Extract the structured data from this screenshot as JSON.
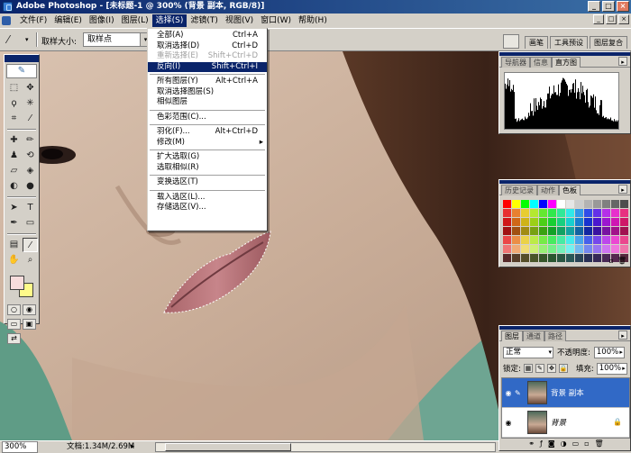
{
  "window": {
    "title": "Adobe Photoshop - [未标题-1 @ 300% (背景 副本, RGB/8)]",
    "minimize": "_",
    "maximize": "□",
    "close": "×"
  },
  "menubar": {
    "items": [
      "文件(F)",
      "编辑(E)",
      "图像(I)",
      "图层(L)",
      "选择(S)",
      "滤镜(T)",
      "视图(V)",
      "窗口(W)",
      "帮助(H)"
    ]
  },
  "options_bar": {
    "label": "取样大小:",
    "value": "取样点",
    "tabs": [
      "画笔",
      "工具预设",
      "图层复合"
    ]
  },
  "select_menu": {
    "items": [
      {
        "label": "全部(A)",
        "shortcut": "Ctrl+A"
      },
      {
        "label": "取消选择(D)",
        "shortcut": "Ctrl+D"
      },
      {
        "label": "重新选择(E)",
        "shortcut": "Shift+Ctrl+D"
      },
      {
        "label": "反向(I)",
        "shortcut": "Shift+Ctrl+I"
      },
      {
        "label": "所有图层(Y)",
        "shortcut": "Alt+Ctrl+A"
      },
      {
        "label": "取消选择图层(S)",
        "shortcut": ""
      },
      {
        "label": "相似图层",
        "shortcut": ""
      },
      {
        "label": "色彩范围(C)...",
        "shortcut": ""
      },
      {
        "label": "羽化(F)...",
        "shortcut": "Alt+Ctrl+D"
      },
      {
        "label": "修改(M)",
        "shortcut": ""
      },
      {
        "label": "扩大选取(G)",
        "shortcut": ""
      },
      {
        "label": "选取相似(R)",
        "shortcut": ""
      },
      {
        "label": "变换选区(T)",
        "shortcut": ""
      },
      {
        "label": "载入选区(L)...",
        "shortcut": ""
      },
      {
        "label": "存储选区(V)...",
        "shortcut": ""
      }
    ]
  },
  "histogram_palette": {
    "tabs": [
      "导航器",
      "信息",
      "直方图"
    ]
  },
  "swatches_palette": {
    "tabs": [
      "历史记录",
      "动作",
      "色板"
    ]
  },
  "layers_palette": {
    "tabs": [
      "图层",
      "通道",
      "路径"
    ],
    "blend_mode": "正常",
    "opacity_label": "不透明度:",
    "opacity": "100%",
    "lock_label": "锁定:",
    "fill_label": "填充:",
    "fill": "100%",
    "layers": [
      {
        "name": "背景 副本",
        "selected": true
      },
      {
        "name": "背景",
        "selected": false
      }
    ]
  },
  "status": {
    "zoom": "300%",
    "docinfo": "文档:1.34M/2.69M"
  },
  "colors": {
    "foreground": "#f7dcdc",
    "background": "#fffb8a",
    "highlight": "#0a246a"
  }
}
